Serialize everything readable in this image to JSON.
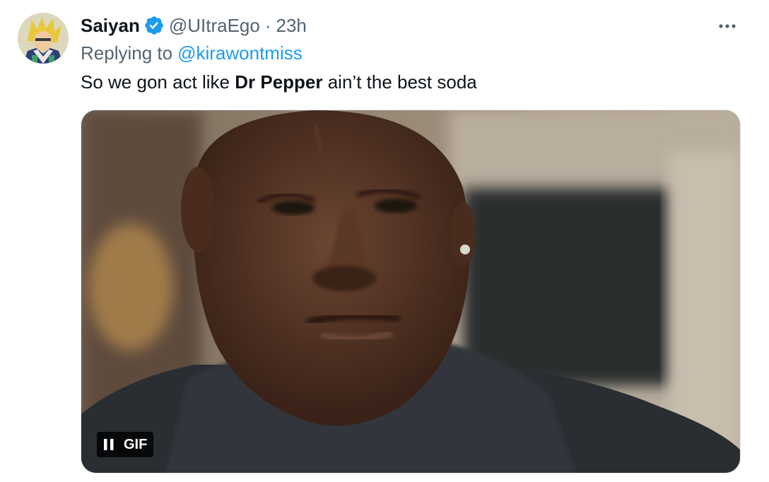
{
  "author": {
    "display_name": "Saiyan",
    "handle": "@UItraEgo",
    "separator": "·",
    "time": "23h"
  },
  "reply": {
    "prefix": "Replying to",
    "handle": "@kirawontmiss"
  },
  "tweet": {
    "text_before": "So we gon act like ",
    "text_bold": "Dr Pepper",
    "text_after": " ain’t the best soda"
  },
  "media": {
    "badge_label": "GIF",
    "control_icon": "pause-icon"
  },
  "icons": {
    "verified": "verified-badge-icon",
    "more": "more-options-icon"
  },
  "colors": {
    "link": "#1d9bf0",
    "secondary_text": "#536471",
    "primary_text": "#0f1419",
    "verified": "#1d9bf0"
  }
}
